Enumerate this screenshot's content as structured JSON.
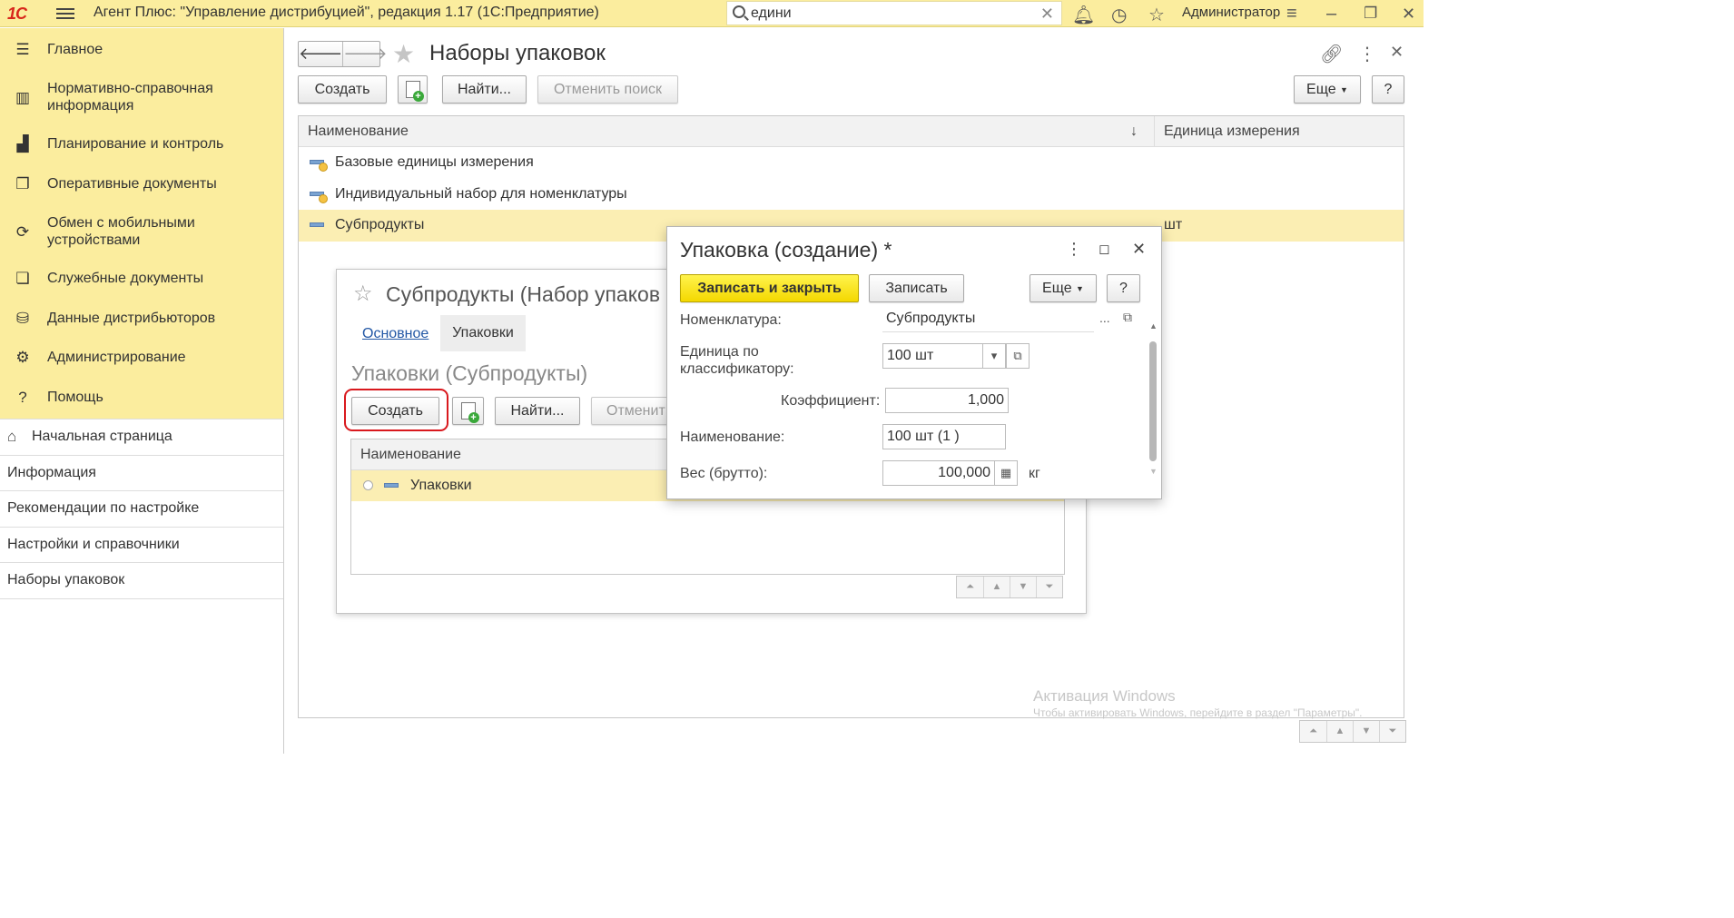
{
  "topbar": {
    "logo": "1С",
    "app_title": "Агент Плюс: \"Управление дистрибуцией\", редакция 1.17  (1С:Предприятие)",
    "search_value": "едини",
    "user": "Администратор",
    "icons": [
      "bell-icon",
      "history-icon",
      "star-icon",
      "settings-lines-icon",
      "minimize-icon",
      "restore-icon",
      "close-icon"
    ]
  },
  "sidebar": {
    "sections": [
      {
        "label": "Главное",
        "icon": "menu-lines-icon"
      },
      {
        "label": "Нормативно-справочная информация",
        "icon": "book-icon"
      },
      {
        "label": "Планирование и контроль",
        "icon": "chart-icon"
      },
      {
        "label": "Оперативные документы",
        "icon": "documents-icon"
      },
      {
        "label": "Обмен с мобильными устройствами",
        "icon": "sync-icon"
      },
      {
        "label": "Служебные документы",
        "icon": "service-docs-icon"
      },
      {
        "label": "Данные дистрибьюторов",
        "icon": "distributors-icon"
      },
      {
        "label": "Администрирование",
        "icon": "gear-icon"
      },
      {
        "label": "Помощь",
        "icon": "question-icon"
      }
    ],
    "nav": [
      {
        "label": "Начальная страница"
      },
      {
        "label": "Информация"
      },
      {
        "label": "Рекомендации по настройке"
      },
      {
        "label": "Настройки и справочники"
      },
      {
        "label": "Наборы упаковок"
      }
    ]
  },
  "main": {
    "title": "Наборы упаковок",
    "toolbar": {
      "create": "Создать",
      "find": "Найти...",
      "cancel_search": "Отменить поиск",
      "more": "Еще",
      "help": "?"
    },
    "table": {
      "columns": [
        "Наименование",
        "Единица измерения"
      ],
      "sort_indicator": "↓",
      "rows": [
        {
          "name": "Базовые единицы измерения",
          "unit": ""
        },
        {
          "name": "Индивидуальный набор для номенклатуры",
          "unit": ""
        },
        {
          "name": "Субпродукты",
          "unit": "шт"
        }
      ]
    }
  },
  "child_window": {
    "title": "Субпродукты (Набор упаков",
    "tabs": [
      "Основное",
      "Упаковки"
    ],
    "subheading": "Упаковки (Субпродукты)",
    "toolbar": {
      "create": "Создать",
      "find": "Найти...",
      "cancel": "Отменит"
    },
    "table": {
      "column": "Наименование",
      "rows": [
        {
          "name": "Упаковки"
        }
      ]
    }
  },
  "dialog": {
    "title": "Упаковка (создание) *",
    "buttons": {
      "save_close": "Записать и закрыть",
      "save": "Записать",
      "more": "Еще",
      "help": "?"
    },
    "fields": {
      "nomenclature_label": "Номенклатура:",
      "nomenclature_value": "Субпродукты",
      "unit_label_1": "Единица по",
      "unit_label_2": "классификатору:",
      "unit_value": "100 шт",
      "coef_label": "Коэффициент:",
      "coef_value": "1,000",
      "name_label": "Наименование:",
      "name_value": "100 шт (1 )",
      "weight_label": "Вес (брутто):",
      "weight_value": "100,000",
      "weight_unit": "кг"
    }
  },
  "watermark": {
    "line1": "Активация Windows",
    "line2": "Чтобы активировать Windows, перейдите в раздел \"Параметры\"."
  }
}
